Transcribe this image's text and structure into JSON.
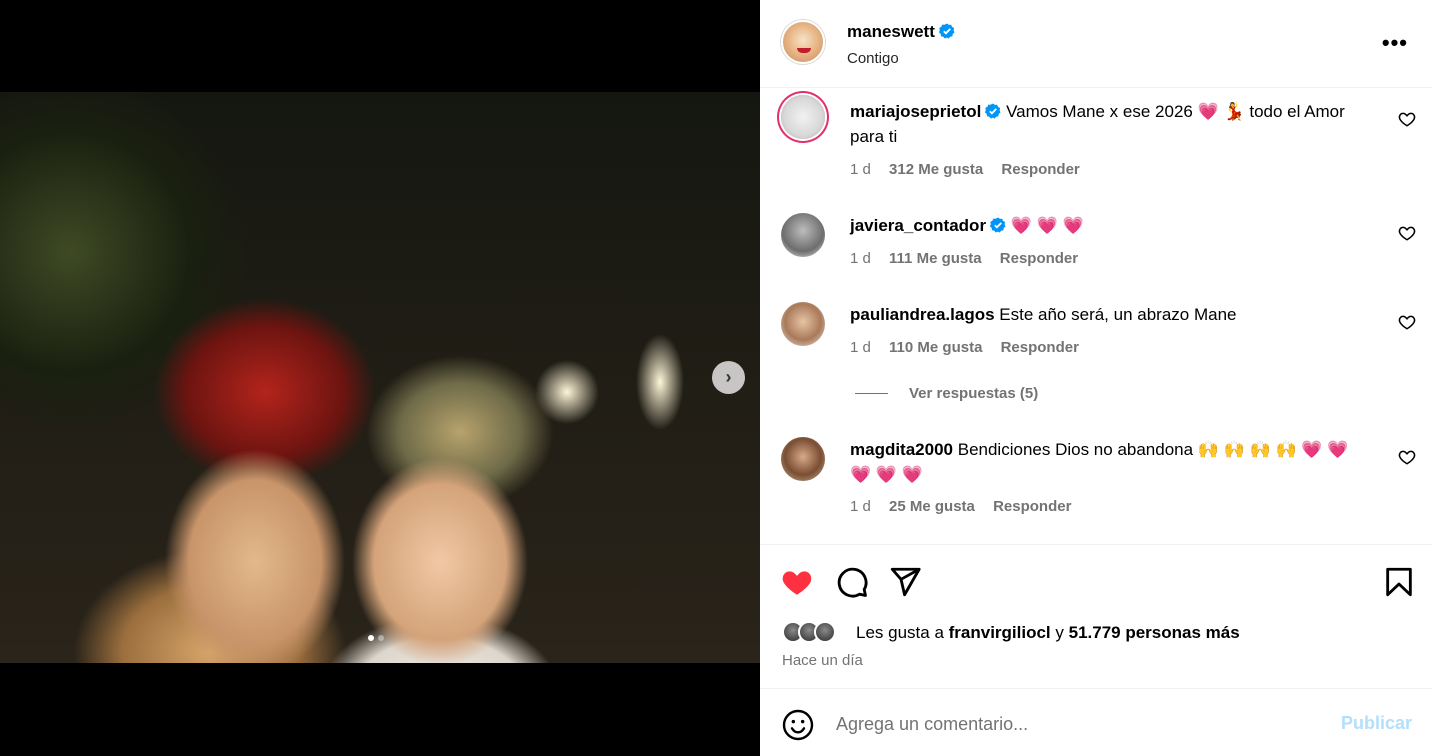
{
  "post": {
    "username": "maneswett",
    "subtitle": "Contigo",
    "carousel": {
      "total": 2,
      "current": 1
    }
  },
  "comments": [
    {
      "username": "mariajoseprietol",
      "verified": true,
      "text": "Vamos Mane x ese 2026 💗 💃  todo el Amor para ti",
      "time": "1 d",
      "likes": "312 Me gusta",
      "reply": "Responder"
    },
    {
      "username": "javiera_contador",
      "verified": true,
      "text": "💗 💗 💗",
      "time": "1 d",
      "likes": "111 Me gusta",
      "reply": "Responder"
    },
    {
      "username": "pauliandrea.lagos",
      "verified": false,
      "text": "Este año será, un abrazo Mane",
      "time": "1 d",
      "likes": "110 Me gusta",
      "reply": "Responder"
    },
    {
      "username": "magdita2000",
      "verified": false,
      "text": "Bendiciones Dios no abandona 🙌 🙌 🙌 🙌 💗 💗 💗 💗 💗",
      "time": "1 d",
      "likes": "25 Me gusta",
      "reply": "Responder"
    }
  ],
  "replies_link": "Ver respuestas (5)",
  "likes_summary": {
    "prefix": "Les gusta a ",
    "user": "franvirgiliocl",
    "middle": " y ",
    "count": "51.779 personas más"
  },
  "timestamp": "Hace un día",
  "comment_box": {
    "placeholder": "Agrega un comentario...",
    "publish": "Publicar"
  },
  "colors": {
    "verified": "#0095f6",
    "liked": "#ff3040",
    "publish_disabled": "#b2dffc"
  },
  "icons": [
    "more-options-icon",
    "next-arrow-icon",
    "heart-icon",
    "comment-icon",
    "share-icon",
    "save-icon",
    "emoji-icon",
    "verified-badge-icon"
  ]
}
